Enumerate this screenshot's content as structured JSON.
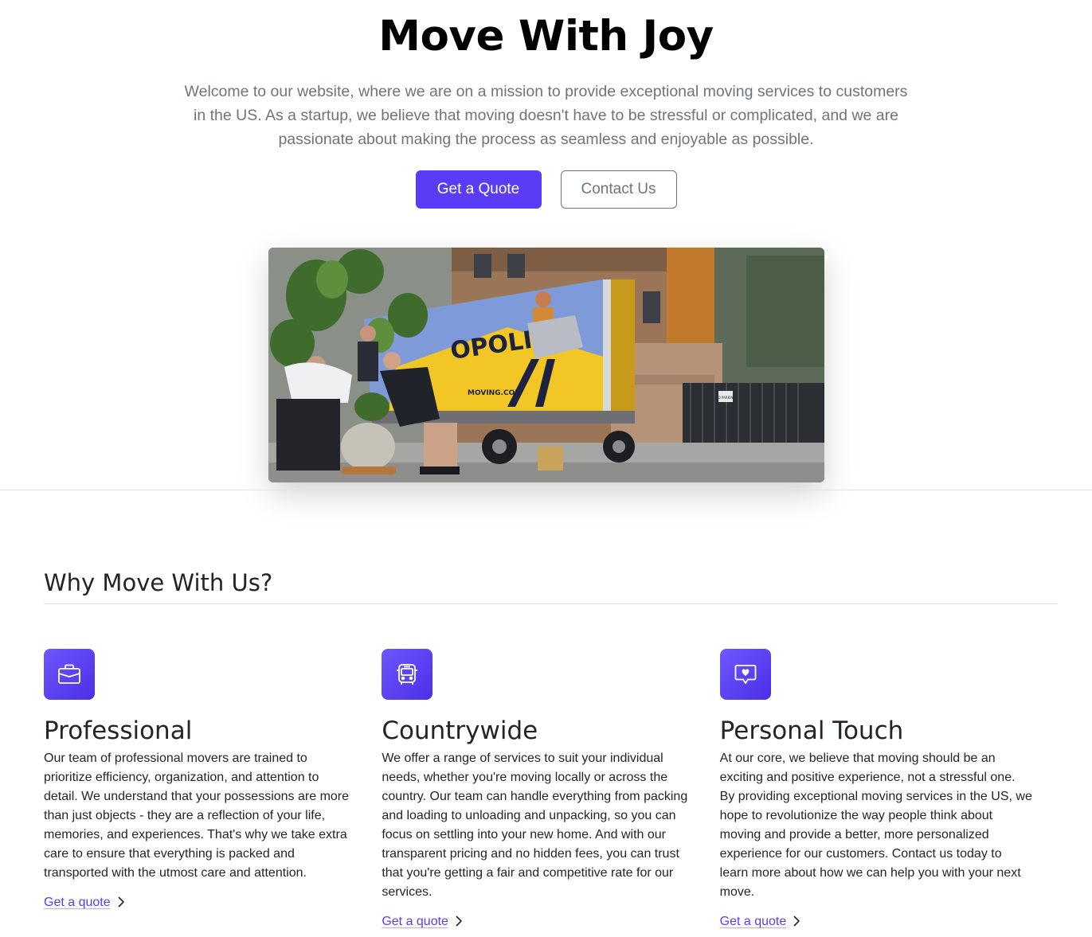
{
  "hero": {
    "title": "Move With Joy",
    "lead": "Welcome to our website, where we are on a mission to provide exceptional moving services to customers in the US. As a startup, we believe that moving doesn't have to be stressful or complicated, and we are passionate about making the process as seamless and enjoyable as possible.",
    "primary_button": "Get a Quote",
    "secondary_button": "Contact Us",
    "image": {
      "truck_text_1": "OPOLIS",
      "truck_text_2": "MOVING.COM",
      "sign_text": "NO PARKING"
    }
  },
  "features": {
    "heading": "Why Move With Us?",
    "items": [
      {
        "icon": "briefcase-icon",
        "title": "Professional",
        "text": "Our team of professional movers are trained to prioritize efficiency, organization, and attention to detail. We understand that your possessions are more than just objects - they are a reflection of your life, memories, and experiences. That's why we take extra care to ensure that everything is packed and transported with the utmost care and attention.",
        "link": "Get a quote"
      },
      {
        "icon": "bus-icon",
        "title": "Countrywide",
        "text": "We offer a range of services to suit your individual needs, whether you're moving locally or across the country. Our team can handle everything from packing and loading to unloading and unpacking, so you can focus on settling into your new home. And with our transparent pricing and no hidden fees, you can trust that you're getting a fair and competitive rate for our services.",
        "link": "Get a quote"
      },
      {
        "icon": "chat-heart-icon",
        "title": "Personal Touch",
        "text": "At our core, we believe that moving should be an exciting and positive experience, not a stressful one. By providing exceptional moving services in the US, we hope to revolutionize the way people think about moving and provide a better, more personalized experience for our customers. Contact us today to learn more about how we can help you with your next move.",
        "link": "Get a quote"
      }
    ]
  },
  "colors": {
    "accent": "#5b3cf6",
    "muted": "#6c757d"
  }
}
